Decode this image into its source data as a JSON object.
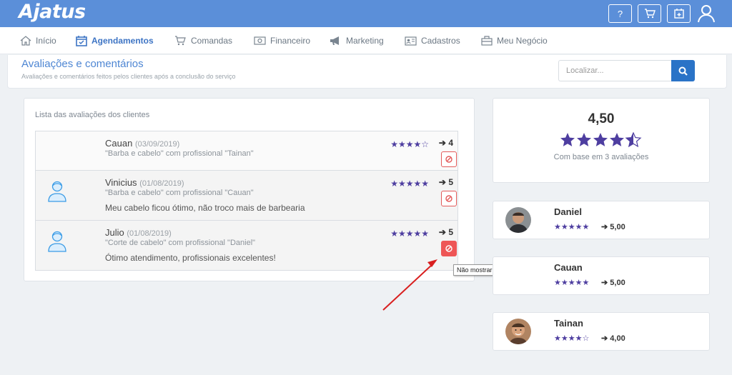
{
  "app": {
    "logo": "Ajatus"
  },
  "topbar": {
    "help_label": "?",
    "buttons": [
      "help-button",
      "cart-button",
      "calendar-button",
      "user-button"
    ]
  },
  "menu": {
    "items": [
      {
        "label": "Início",
        "icon": "home-icon"
      },
      {
        "label": "Agendamentos",
        "icon": "calendar-check-icon",
        "active": true
      },
      {
        "label": "Comandas",
        "icon": "cart-icon"
      },
      {
        "label": "Financeiro",
        "icon": "money-icon"
      },
      {
        "label": "Marketing",
        "icon": "megaphone-icon"
      },
      {
        "label": "Cadastros",
        "icon": "id-card-icon"
      },
      {
        "label": "Meu Negócio",
        "icon": "briefcase-icon"
      }
    ]
  },
  "header": {
    "title": "Avaliações e comentários",
    "subtitle": "Avaliações e comentários feitos pelos clientes após a conclusão do serviço",
    "search_placeholder": "Localizar..."
  },
  "reviews": {
    "title": "Lista das avaliações dos clientes",
    "items": [
      {
        "name": "Cauan",
        "date": "(03/09/2019)",
        "service": "\"Barba e cabelo\" com profissional \"Tainan\"",
        "comment": "",
        "rating": 4,
        "score": "4"
      },
      {
        "name": "Vinicius",
        "date": "(01/08/2019)",
        "service": "\"Barba e cabelo\" com profissional \"Cauan\"",
        "comment": "Meu cabelo ficou ótimo, não troco mais de barbearia",
        "rating": 5,
        "score": "5"
      },
      {
        "name": "Julio",
        "date": "(01/08/2019)",
        "service": "\"Corte de cabelo\" com profissional \"Daniel\"",
        "comment": "Ótimo atendimento, profissionais excelentes!",
        "rating": 5,
        "score": "5"
      }
    ],
    "tooltip": "Não mostrar"
  },
  "summary": {
    "average": "4,50",
    "rating": 4.5,
    "based_on": "Com base em 3 avaliações"
  },
  "professionals": [
    {
      "name": "Daniel",
      "rating": 5,
      "score": "5,00"
    },
    {
      "name": "Cauan",
      "rating": 5,
      "score": "5,00"
    },
    {
      "name": "Tainan",
      "rating": 4,
      "score": "4,00"
    }
  ],
  "colors": {
    "topbar": "#5b8fd9",
    "accent": "#3d74c4",
    "star": "#4e3ea0",
    "danger": "#ee5656"
  }
}
